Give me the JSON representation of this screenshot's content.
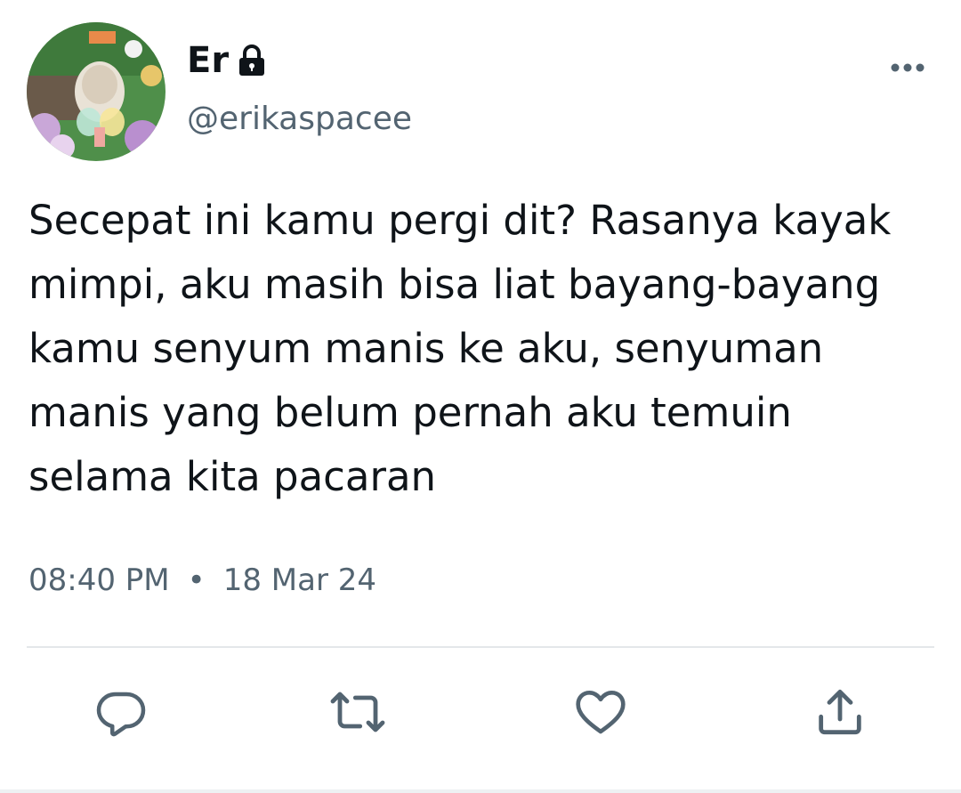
{
  "user": {
    "display_name": "Er",
    "handle": "@erikaspacee",
    "protected_icon": "lock-icon"
  },
  "tweet": {
    "text": "Secepat ini kamu pergi dit? Rasanya kayak\nmimpi, aku masih bisa liat bayang-bayang\nkamu senyum manis ke aku, senyuman\nmanis yang belum pernah aku temuin\nselama kita pacaran",
    "time": "08:40 PM",
    "separator": "•",
    "date": "18 Mar 24"
  },
  "actions": {
    "reply_icon": "reply-icon",
    "retweet_icon": "retweet-icon",
    "like_icon": "like-icon",
    "share_icon": "share-icon",
    "more_icon": "more-options-icon"
  },
  "colors": {
    "text_primary": "#0f1419",
    "text_secondary": "#536471",
    "divider": "#e4e7ea"
  }
}
